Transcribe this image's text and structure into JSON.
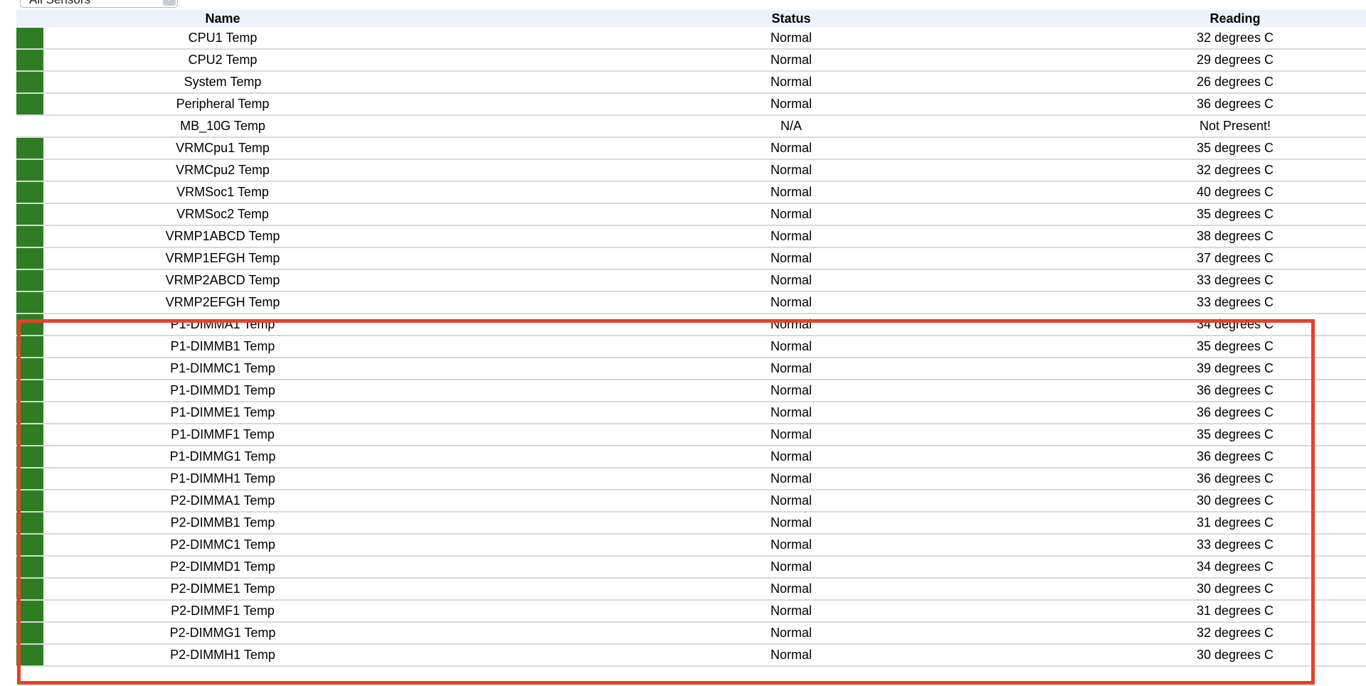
{
  "filter": {
    "selected": "All Sensors"
  },
  "table": {
    "headers": {
      "name": "Name",
      "status": "Status",
      "reading": "Reading"
    },
    "rows": [
      {
        "name": "CPU1 Temp",
        "status": "Normal",
        "reading": "32 degrees C",
        "state": "ok"
      },
      {
        "name": "CPU2 Temp",
        "status": "Normal",
        "reading": "29 degrees C",
        "state": "ok"
      },
      {
        "name": "System Temp",
        "status": "Normal",
        "reading": "26 degrees C",
        "state": "ok"
      },
      {
        "name": "Peripheral Temp",
        "status": "Normal",
        "reading": "36 degrees C",
        "state": "ok"
      },
      {
        "name": "MB_10G Temp",
        "status": "N/A",
        "reading": "Not Present!",
        "state": "none"
      },
      {
        "name": "VRMCpu1 Temp",
        "status": "Normal",
        "reading": "35 degrees C",
        "state": "ok"
      },
      {
        "name": "VRMCpu2 Temp",
        "status": "Normal",
        "reading": "32 degrees C",
        "state": "ok"
      },
      {
        "name": "VRMSoc1 Temp",
        "status": "Normal",
        "reading": "40 degrees C",
        "state": "ok"
      },
      {
        "name": "VRMSoc2 Temp",
        "status": "Normal",
        "reading": "35 degrees C",
        "state": "ok"
      },
      {
        "name": "VRMP1ABCD Temp",
        "status": "Normal",
        "reading": "38 degrees C",
        "state": "ok"
      },
      {
        "name": "VRMP1EFGH Temp",
        "status": "Normal",
        "reading": "37 degrees C",
        "state": "ok"
      },
      {
        "name": "VRMP2ABCD Temp",
        "status": "Normal",
        "reading": "33 degrees C",
        "state": "ok"
      },
      {
        "name": "VRMP2EFGH Temp",
        "status": "Normal",
        "reading": "33 degrees C",
        "state": "ok"
      },
      {
        "name": "P1-DIMMA1 Temp",
        "status": "Normal",
        "reading": "34 degrees C",
        "state": "ok"
      },
      {
        "name": "P1-DIMMB1 Temp",
        "status": "Normal",
        "reading": "35 degrees C",
        "state": "ok"
      },
      {
        "name": "P1-DIMMC1 Temp",
        "status": "Normal",
        "reading": "39 degrees C",
        "state": "ok"
      },
      {
        "name": "P1-DIMMD1 Temp",
        "status": "Normal",
        "reading": "36 degrees C",
        "state": "ok"
      },
      {
        "name": "P1-DIMME1 Temp",
        "status": "Normal",
        "reading": "36 degrees C",
        "state": "ok"
      },
      {
        "name": "P1-DIMMF1 Temp",
        "status": "Normal",
        "reading": "35 degrees C",
        "state": "ok"
      },
      {
        "name": "P1-DIMMG1 Temp",
        "status": "Normal",
        "reading": "36 degrees C",
        "state": "ok"
      },
      {
        "name": "P1-DIMMH1 Temp",
        "status": "Normal",
        "reading": "36 degrees C",
        "state": "ok"
      },
      {
        "name": "P2-DIMMA1 Temp",
        "status": "Normal",
        "reading": "30 degrees C",
        "state": "ok"
      },
      {
        "name": "P2-DIMMB1 Temp",
        "status": "Normal",
        "reading": "31 degrees C",
        "state": "ok"
      },
      {
        "name": "P2-DIMMC1 Temp",
        "status": "Normal",
        "reading": "33 degrees C",
        "state": "ok"
      },
      {
        "name": "P2-DIMMD1 Temp",
        "status": "Normal",
        "reading": "34 degrees C",
        "state": "ok"
      },
      {
        "name": "P2-DIMME1 Temp",
        "status": "Normal",
        "reading": "30 degrees C",
        "state": "ok"
      },
      {
        "name": "P2-DIMMF1 Temp",
        "status": "Normal",
        "reading": "31 degrees C",
        "state": "ok"
      },
      {
        "name": "P2-DIMMG1 Temp",
        "status": "Normal",
        "reading": "32 degrees C",
        "state": "ok"
      },
      {
        "name": "P2-DIMMH1 Temp",
        "status": "Normal",
        "reading": "30 degrees C",
        "state": "ok"
      }
    ]
  },
  "colors": {
    "ok_indicator": "#2e7d23",
    "header_bg": "#eef2fa",
    "highlight_border": "#e8402a",
    "row_divider": "#d9d9d9"
  },
  "icons": {
    "filter_dropdown": "chevron-down-icon"
  }
}
